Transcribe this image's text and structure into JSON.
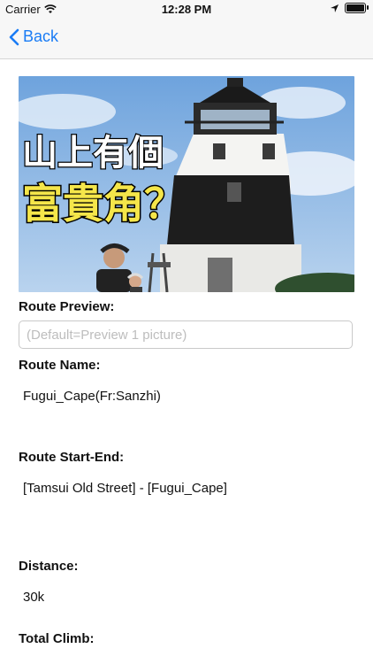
{
  "status_bar": {
    "carrier": "Carrier",
    "time": "12:28 PM"
  },
  "nav": {
    "back_label": "Back"
  },
  "photo": {
    "text_line1": "山上有個",
    "text_line2": "富貴角？"
  },
  "preview": {
    "label": "Route Preview:",
    "placeholder": "(Default=Preview 1 picture)"
  },
  "route_name": {
    "label": "Route Name:",
    "value": "Fugui_Cape(Fr:Sanzhi)"
  },
  "route_start_end": {
    "label": "Route Start-End:",
    "value": "[Tamsui Old Street] - [Fugui_Cape]"
  },
  "distance": {
    "label": "Distance:",
    "value": "30k"
  },
  "total_climb": {
    "label": "Total Climb:"
  },
  "colors": {
    "accent": "#1a7cf5",
    "sky": "#8fb9e6"
  }
}
